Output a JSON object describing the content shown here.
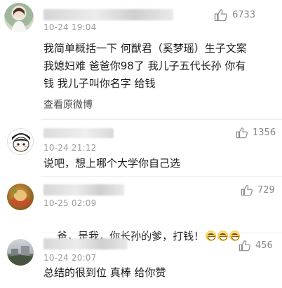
{
  "comments": [
    {
      "time": "10-24 19:04",
      "likes": "6733",
      "text": "我简单概括一下 何猷君（奚梦瑶）生子文案\n我媳妇难 爸爸你98了 我儿子五代长孙 你有\n钱 我儿子叫你名字 给钱",
      "link": "查看原微博"
    },
    {
      "time": "10-24 21:12",
      "likes": "1356",
      "text": "说吧，想上哪个大学你自己选"
    },
    {
      "time": "10-25 02:09",
      "likes": "729",
      "text": "爸，是我，你长孙的爹，打钱！"
    },
    {
      "time": "10-24 20:07",
      "likes": "456",
      "text": "总结的很到位 真棒 给你赞"
    }
  ],
  "icons": {
    "like": "thumbs-up-icon",
    "emoji": "grin-emoji-icon"
  }
}
